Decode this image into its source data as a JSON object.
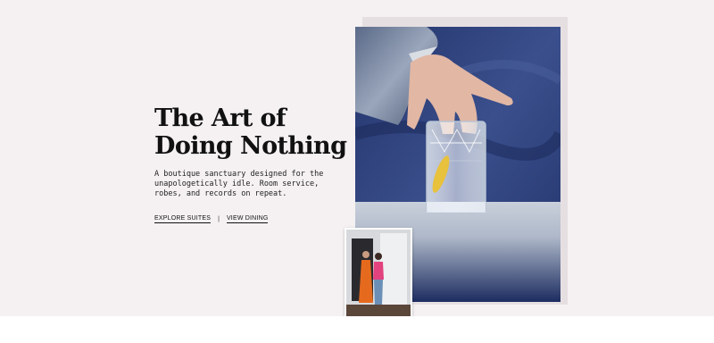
{
  "hero": {
    "headline": "The Art of Doing Nothing",
    "description": "A boutique sanctuary designed for the unapologetically idle. Room service, robes, and records on repeat.",
    "links": {
      "explore_suites": "EXPLORE SUITES",
      "separator": "|",
      "view_dining": "VIEW DINING"
    }
  },
  "images": {
    "main": "photo-hand-reaching-for-cocktail-glass",
    "secondary": "photo-two-people-in-doorway"
  },
  "colors": {
    "background": "#f5f1f2",
    "text": "#111111",
    "velvet_blue": "#2b3f7a"
  }
}
